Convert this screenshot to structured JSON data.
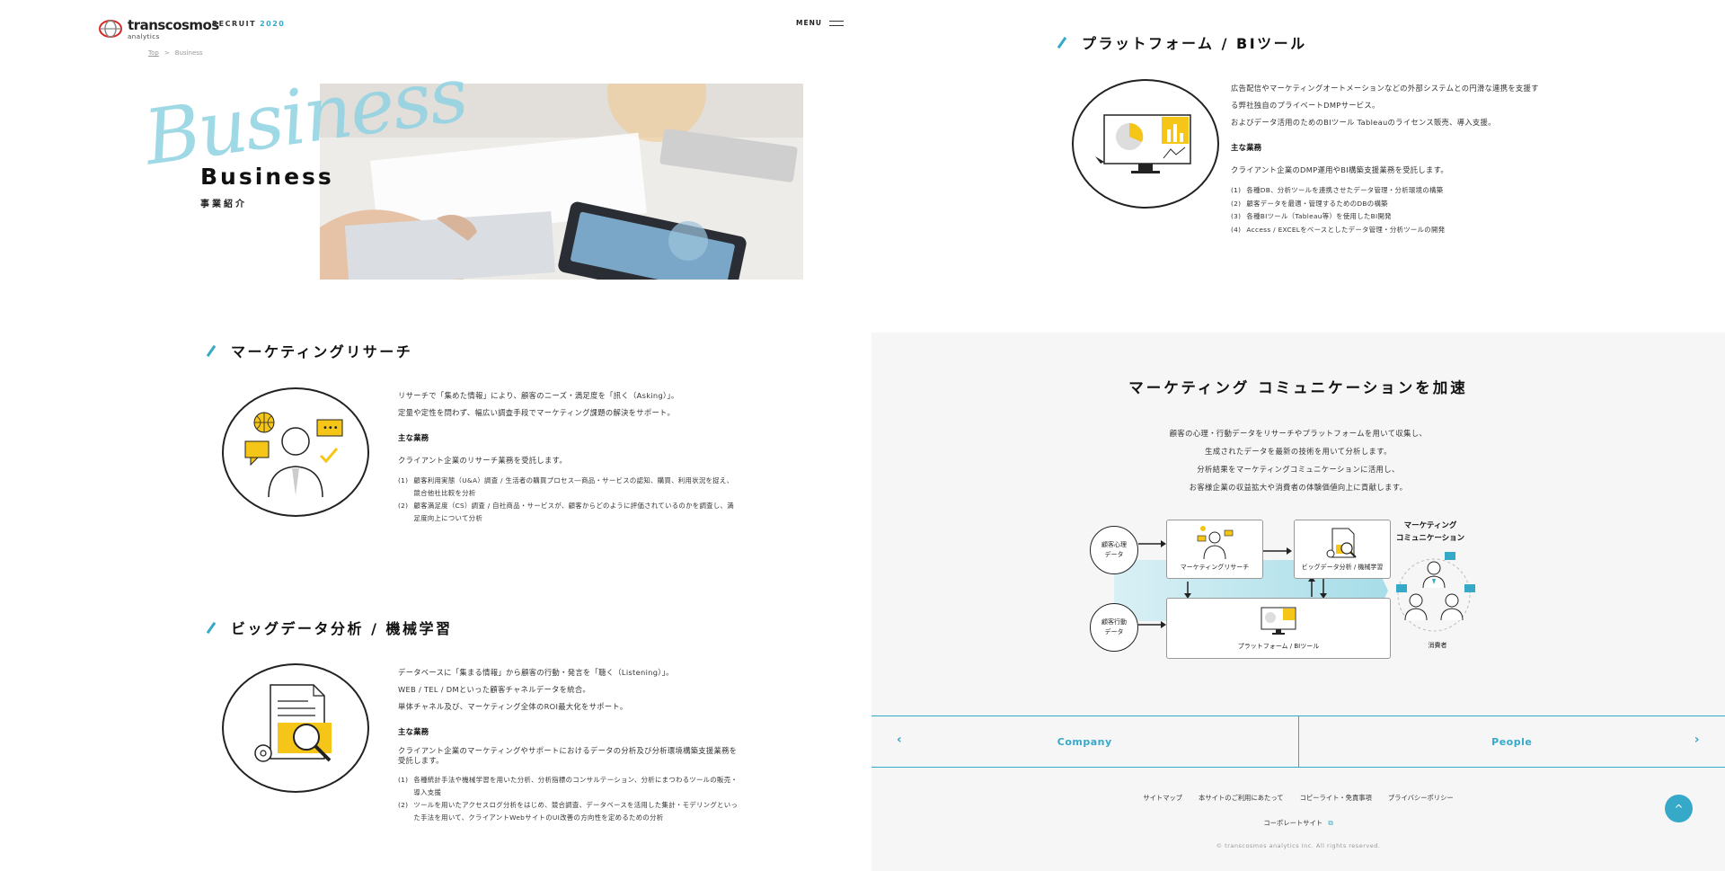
{
  "header": {
    "logo_text": "transcosmos",
    "logo_sub": "analytics",
    "recruit_label": "RECRUIT",
    "recruit_year": "2020",
    "menu_label": "MENU"
  },
  "breadcrumb": {
    "top": "Top",
    "separator": ">",
    "current": "Business"
  },
  "hero": {
    "script_text": "Business",
    "title": "Business",
    "subtitle": "事業紹介"
  },
  "sections": {
    "research": {
      "heading": "マーケティングリサーチ",
      "intro": [
        "リサーチで「集めた情報」により、顧客のニーズ・満足度を「訊く（Asking）」。",
        "定量や定性を問わず、幅広い調査手段でマーケティング課題の解決をサポート。"
      ],
      "main_label": "主な業務",
      "main_text": "クライアント企業のリサーチ業務を受託します。",
      "items": [
        {
          "n": "(1)",
          "text": "顧客利用実態（U&A）調査 / 生活者の購買プロセス―商品・サービスの認知、購買、利用状況を捉え、競合他社比較を分析"
        },
        {
          "n": "(2)",
          "text": "顧客満足度（CS）調査 / 自社商品・サービスが、顧客からどのように評価されているのかを調査し、満足度向上について分析"
        }
      ]
    },
    "bigdata": {
      "heading": "ビッグデータ分析 / 機械学習",
      "intro": [
        "データベースに「集まる情報」から顧客の行動・発言を「聴く（Listening）」。",
        "WEB / TEL / DMといった顧客チャネルデータを統合。",
        "単体チャネル及び、マーケティング全体のROI最大化をサポート。"
      ],
      "main_label": "主な業務",
      "main_text": "クライアント企業のマーケティングやサポートにおけるデータの分析及び分析環境構築支援業務を受託します。",
      "items": [
        {
          "n": "(1)",
          "text": "各種統計手法や機械学習を用いた分析、分析指標のコンサルテーション、分析にまつわるツールの販売・導入支援"
        },
        {
          "n": "(2)",
          "text": "ツールを用いたアクセスログ分析をはじめ、競合調査、データベースを活用した集計・モデリングといった手法を用いて、クライアントWebサイトのUI改善の方向性を定めるための分析"
        }
      ]
    },
    "platform": {
      "heading": "プラットフォーム / BIツール",
      "intro": [
        "広告配信やマーケティングオートメーションなどの外部システムとの円滑な連携を支援する弊社独自のプライベートDMPサービス。",
        "およびデータ活用のためのBIツール Tableauのライセンス販売、導入支援。"
      ],
      "main_label": "主な業務",
      "main_text": "クライアント企業のDMP運用やBI構築支援業務を受託します。",
      "items": [
        {
          "n": "(1)",
          "text": "各種DB、分析ツールを連携させたデータ管理・分析環境の構築"
        },
        {
          "n": "(2)",
          "text": "顧客データを最適・管理するためのDBの構築"
        },
        {
          "n": "(3)",
          "text": "各種BIツール（Tableau等）を使用したBI開発"
        },
        {
          "n": "(4)",
          "text": "Access / EXCELをベースとしたデータ管理・分析ツールの開発"
        }
      ]
    }
  },
  "accelerate": {
    "heading": "マーケティング コミュニケーションを加速",
    "lines": [
      "顧客の心理・行動データをリサーチやプラットフォームを用いて収集し、",
      "生成されたデータを最新の技術を用いて分析します。",
      "分析結果をマーケティングコミュニケーションに活用し、",
      "お客様企業の収益拡大や消費者の体験価値向上に貢献します。"
    ],
    "diagram": {
      "psych": "顧客心理データ",
      "behavior": "顧客行動データ",
      "research": "マーケティングリサーチ",
      "bigdata": "ビッグデータ分析 / 機械学習",
      "platform": "プラットフォーム / BIツール",
      "comm_title": "マーケティング\nコミュニケーション",
      "consumer": "消費者"
    }
  },
  "pager": {
    "prev": "Company",
    "next": "People"
  },
  "footer": {
    "links": [
      "サイトマップ",
      "本サイトのご利用にあたって",
      "コピーライト・免責事項",
      "プライバシーポリシー"
    ],
    "corporate": "コーポレートサイト",
    "copyright": "© transcosmos analytics Inc. All rights reserved."
  },
  "colors": {
    "accent": "#36a9c9",
    "yellow": "#f5c518",
    "text": "#222222",
    "grey_bg": "#f6f6f6"
  },
  "icons": [
    "globe-icon",
    "speech-bubble-icon",
    "check-icon",
    "person-icon",
    "document-icon",
    "magnifier-icon",
    "gear-icon",
    "monitor-icon",
    "arrow-up-icon",
    "chevron-left-icon",
    "chevron-right-icon",
    "external-link-icon"
  ]
}
